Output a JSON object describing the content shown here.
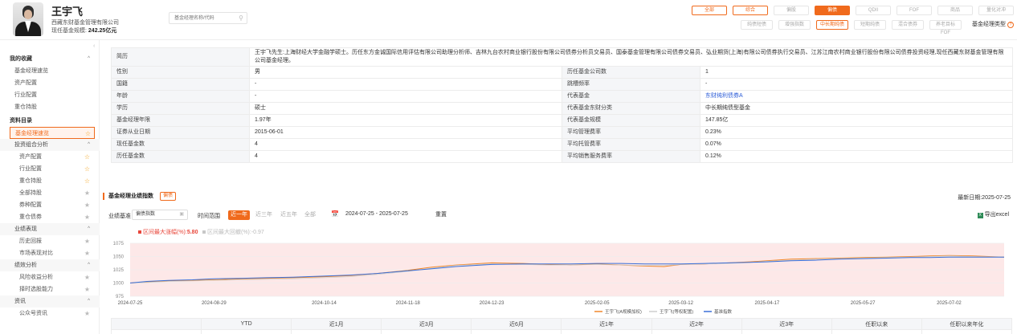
{
  "manager": {
    "name": "王宇飞",
    "company": "西藏东财基金管理有限公司",
    "scale_label": "现任基金规模:",
    "scale_value": "242.25亿元"
  },
  "search": {
    "placeholder": "基金经理名称/代码"
  },
  "fund_type_tags": {
    "row1": [
      {
        "label": "全部",
        "state": "active"
      },
      {
        "label": "综合",
        "state": "active"
      },
      {
        "label": "偏股",
        "state": "normal"
      },
      {
        "label": "偏债",
        "state": "selected"
      },
      {
        "label": "QDII",
        "state": "normal"
      },
      {
        "label": "FOF",
        "state": "normal"
      },
      {
        "label": "商品",
        "state": "normal"
      },
      {
        "label": "量化对冲",
        "state": "normal"
      }
    ],
    "row2": [
      {
        "label": "纯债短债",
        "state": "normal"
      },
      {
        "label": "增强指数",
        "state": "normal"
      },
      {
        "label": "中长期纯债",
        "state": "active"
      },
      {
        "label": "短期纯债",
        "state": "normal"
      },
      {
        "label": "混合债券",
        "state": "normal"
      },
      {
        "label": "养老目标FOF",
        "state": "normal"
      }
    ],
    "type_label": "基金经理类型"
  },
  "sidebar": {
    "my_favorites": "我的收藏",
    "fav_items": [
      "基金经理速览",
      "资产配置",
      "行业配置",
      "重仓持股"
    ],
    "catalog": "资料目录",
    "current": "基金经理速览",
    "groups": [
      {
        "label": "投资组合分析",
        "items": [
          {
            "label": "资产配置",
            "starred": true
          },
          {
            "label": "行业配置",
            "starred": true
          },
          {
            "label": "重仓持股",
            "starred": true
          },
          {
            "label": "全部持股",
            "starred": false
          },
          {
            "label": "券种配置",
            "starred": false
          },
          {
            "label": "重仓债券",
            "starred": false
          }
        ]
      },
      {
        "label": "业绩表现",
        "items": [
          {
            "label": "历史回报",
            "starred": false
          },
          {
            "label": "市场表现对比",
            "starred": false
          }
        ]
      },
      {
        "label": "绩效分析",
        "items": [
          {
            "label": "风险收益分析",
            "starred": false
          },
          {
            "label": "择时选股能力",
            "starred": false
          }
        ]
      },
      {
        "label": "资讯",
        "items": [
          {
            "label": "公众号资讯",
            "starred": false
          }
        ]
      }
    ]
  },
  "profile": {
    "bio_label": "简历",
    "bio": "王宇飞先生:上海财经大学金融学硕士。历任东方金诚国际信用评估有限公司助理分析师、吉林九台农村商业银行股份有限公司债券分析员交易员、国泰基金管理有限公司债券交易员、弘业期货(上海)有限公司债券执行交易员、江苏江南农村商业银行股份有限公司债券投资经理,现任西藏东财基金管理有限公司基金经理。",
    "rows": [
      {
        "k1": "性别",
        "v1": "男",
        "k2": "历任基金公司数",
        "v2": "1",
        "link": false
      },
      {
        "k1": "国籍",
        "v1": "-",
        "k2": "跳槽频率",
        "v2": "-",
        "link": false
      },
      {
        "k1": "年龄",
        "v1": "-",
        "k2": "代表基金",
        "v2": "东财纯利债券A",
        "link": true
      },
      {
        "k1": "学历",
        "v1": "硕士",
        "k2": "代表基金东财分类",
        "v2": "中长期纯债型基金",
        "link": false
      },
      {
        "k1": "基金经理年限",
        "v1": "1.97年",
        "k2": "代表基金规模",
        "v2": "147.85亿",
        "link": false
      },
      {
        "k1": "证券从业日期",
        "v1": "2015-06-01",
        "k2": "平均管理费率",
        "v2": "0.23%",
        "link": false
      },
      {
        "k1": "现任基金数",
        "v1": "4",
        "k2": "平均托管费率",
        "v2": "0.07%",
        "link": false
      },
      {
        "k1": "历任基金数",
        "v1": "4",
        "k2": "平均销售服务费率",
        "v2": "0.12%",
        "link": false
      }
    ]
  },
  "performance": {
    "title": "基金经理业绩指数",
    "badge": "偏债",
    "update_date": "最新日期:2025-07-25",
    "benchmark_label": "业绩基准",
    "benchmark_value": "偏债指数",
    "range_label": "时间范围",
    "ranges": [
      "近一年",
      "近三年",
      "近五年",
      "全部"
    ],
    "selected_range": "近一年",
    "date_range": "2024-07-25 - 2025-07-25",
    "reset": "重置",
    "export": "导出excel",
    "stats": [
      {
        "label": "区间最大涨幅(%):",
        "value": "5.80",
        "color": "#e8463a"
      },
      {
        "label": "区间最大回撤(%):",
        "value": "-0.97",
        "color": "#c8c8c8"
      }
    ]
  },
  "chart_data": {
    "type": "line",
    "x_ticks": [
      "2024-07-25",
      "2024-08-29",
      "2024-10-14",
      "2024-11-18",
      "2024-12-23",
      "2025-02-05",
      "2025-03-12",
      "2025-04-17",
      "2025-05-27",
      "2025-07-02"
    ],
    "y_ticks": [
      975,
      1000,
      1025,
      1050,
      1075
    ],
    "ylim": [
      975,
      1075
    ],
    "x": [
      "2024-07-25",
      "2024-08-01",
      "2024-08-10",
      "2024-08-20",
      "2024-08-29",
      "2024-09-10",
      "2024-09-20",
      "2024-10-01",
      "2024-10-14",
      "2024-10-25",
      "2024-11-05",
      "2024-11-18",
      "2024-11-28",
      "2024-12-08",
      "2024-12-23",
      "2025-01-05",
      "2025-01-15",
      "2025-01-25",
      "2025-02-05",
      "2025-02-15",
      "2025-02-25",
      "2025-03-05",
      "2025-03-12",
      "2025-03-22",
      "2025-04-01",
      "2025-04-10",
      "2025-04-17",
      "2025-04-27",
      "2025-05-07",
      "2025-05-17",
      "2025-05-27",
      "2025-06-06",
      "2025-06-16",
      "2025-06-24",
      "2025-07-02",
      "2025-07-12",
      "2025-07-25"
    ],
    "series": [
      {
        "name": "王宇飞(A规模加权)",
        "color": "#f0872a",
        "values": [
          1000,
          1002,
          1004,
          1005,
          1006,
          1008,
          1009,
          1010,
          1012,
          1014,
          1018,
          1024,
          1030,
          1034,
          1038,
          1037,
          1035,
          1034,
          1036,
          1034,
          1032,
          1031,
          1035,
          1036,
          1038,
          1040,
          1042,
          1045,
          1046,
          1047,
          1048,
          1049,
          1050,
          1051,
          1052,
          1051,
          1049
        ]
      },
      {
        "name": "王宇飞(等权配置)",
        "color": "#cfcfcf",
        "values": [
          1000,
          1001,
          1003,
          1004,
          1005,
          1006,
          1007,
          1008,
          1010,
          1012,
          1016,
          1022,
          1028,
          1033,
          1036,
          1035,
          1034,
          1034,
          1035,
          1034,
          1033,
          1033,
          1035,
          1036,
          1037,
          1039,
          1041,
          1043,
          1045,
          1046,
          1047,
          1048,
          1049,
          1050,
          1051,
          1050,
          1049
        ]
      },
      {
        "name": "基准指数",
        "color": "#3a6fd8",
        "values": [
          1000,
          1003,
          1005,
          1006,
          1008,
          1009,
          1010,
          1011,
          1013,
          1015,
          1018,
          1023,
          1027,
          1031,
          1035,
          1036,
          1036,
          1036,
          1037,
          1037,
          1036,
          1036,
          1036,
          1037,
          1038,
          1039,
          1040,
          1042,
          1043,
          1045,
          1046,
          1047,
          1048,
          1048,
          1049,
          1049,
          1049
        ]
      }
    ],
    "shade_color": "#fde8e8",
    "grid": true,
    "legend": "bottom"
  },
  "returns_table": {
    "headers": [
      "",
      "YTD",
      "近1月",
      "近3月",
      "近6月",
      "近1年",
      "近2年",
      "近3年",
      "任职以来",
      "任职以来年化"
    ]
  }
}
